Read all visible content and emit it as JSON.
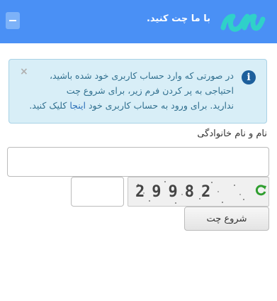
{
  "header": {
    "title": "با ما چت کنید.",
    "logo_icon": "sana-logo-icon",
    "minimize_icon": "minus-icon",
    "background": "#4a90f5"
  },
  "alert": {
    "info_icon": "info-icon",
    "close_icon": "close-icon",
    "text_line1": "در صورتی که وارد حساب کاربری خود شده باشید،",
    "text_line2": "احتیاجی به پر کردن فرم زیر، برای شروع چت",
    "text_line3_before": "ندارید. برای ورود به حساب کاربری خود ",
    "text_link": "اینجا",
    "text_line3_after": " کلیک کنید."
  },
  "form": {
    "name_label": "نام و نام خانوادگی",
    "name_value": "",
    "captcha_value": "",
    "captcha_text": "29982",
    "refresh_icon": "refresh-icon",
    "submit_label": "شروع چت"
  }
}
